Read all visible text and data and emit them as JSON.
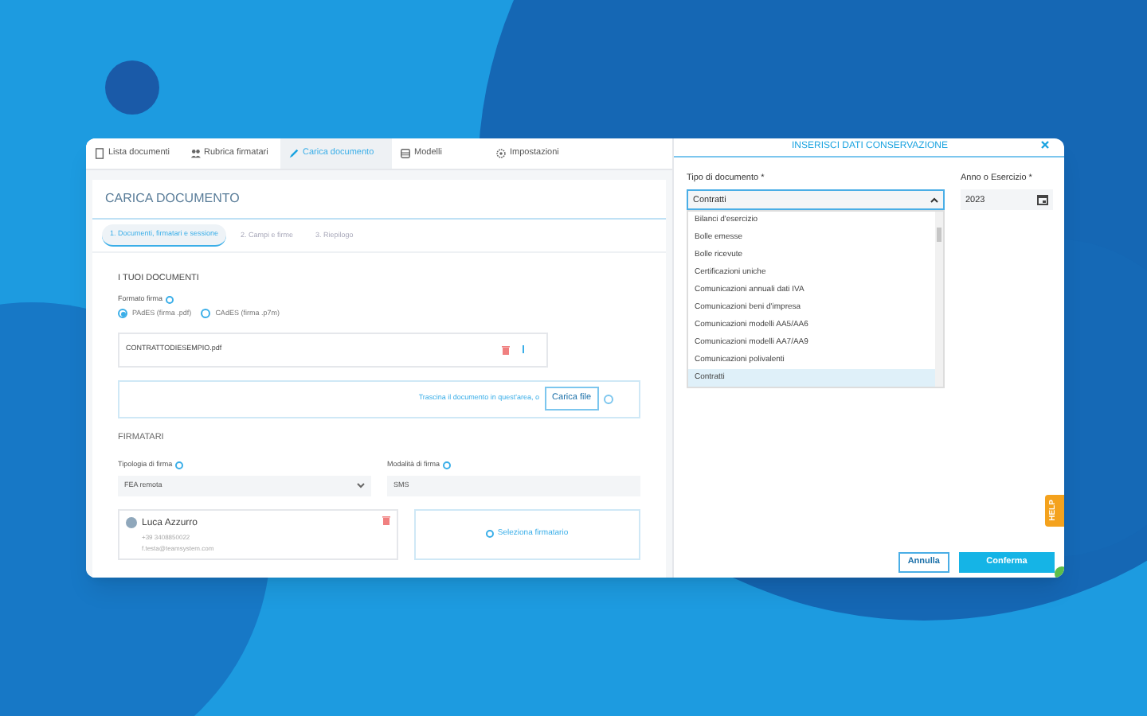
{
  "tabs": [
    {
      "label": "Lista documenti",
      "selected": false
    },
    {
      "label": "Rubrica firmatari",
      "selected": false
    },
    {
      "label": "Carica documento",
      "selected": true
    },
    {
      "label": "Modelli",
      "selected": false
    },
    {
      "label": "Impostazioni",
      "selected": false
    }
  ],
  "page_title": "CARICA DOCUMENTO",
  "steps": [
    {
      "label": "1. Documenti, firmatari e sessione",
      "selected": true
    },
    {
      "label": "2. Campi e firme",
      "selected": false
    },
    {
      "label": "3. Riepilogo",
      "selected": false
    }
  ],
  "documents": {
    "heading": "I TUOI DOCUMENTI",
    "format_label": "Formato firma",
    "formats": [
      {
        "label": "PAdES (firma .pdf)",
        "selected": true
      },
      {
        "label": "CAdES (firma .p7m)",
        "selected": false
      }
    ],
    "file_name": "CONTRATTODIESEMPIO.pdf",
    "drop_text": "Trascina il documento in quest'area, o",
    "upload_button": "Carica file"
  },
  "signers": {
    "heading": "FIRMATARI",
    "fields": [
      {
        "label": "Tipologia di firma",
        "value": "FEA remota",
        "kind": "select"
      },
      {
        "label": "Modalità di firma",
        "value": "SMS",
        "kind": "text"
      }
    ],
    "signer": {
      "name": "Luca Azzurro",
      "phone": "+39 3408850022",
      "email": "f.testa@teamsystem.com"
    },
    "add_signer": "Seleziona firmatario"
  },
  "modal": {
    "title": "INSERISCI DATI CONSERVAZIONE",
    "doc_type": {
      "label": "Tipo di documento *",
      "value": "Contratti",
      "expanded": true
    },
    "options": [
      {
        "label": "Bilanci d'esercizio",
        "selected": false
      },
      {
        "label": "Bolle emesse",
        "selected": false
      },
      {
        "label": "Bolle ricevute",
        "selected": false
      },
      {
        "label": "Certificazioni uniche",
        "selected": false
      },
      {
        "label": "Comunicazioni annuali dati IVA",
        "selected": false
      },
      {
        "label": "Comunicazioni beni d'impresa",
        "selected": false
      },
      {
        "label": "Comunicazioni modelli AA5/AA6",
        "selected": false
      },
      {
        "label": "Comunicazioni modelli AA7/AA9",
        "selected": false
      },
      {
        "label": "Comunicazioni polivalenti",
        "selected": false
      },
      {
        "label": "Contratti",
        "selected": true
      }
    ],
    "year": {
      "label": "Anno o Esercizio *",
      "value": "2023"
    },
    "cancel": "Annulla",
    "confirm": "Conferma"
  },
  "help": "HELP"
}
